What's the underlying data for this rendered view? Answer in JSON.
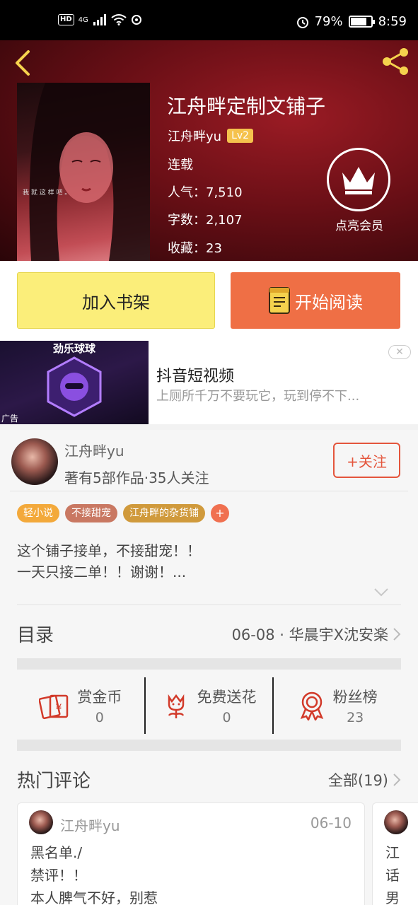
{
  "status_bar": {
    "hd": "HD",
    "network": "4G",
    "battery_percent": "79%",
    "battery_level": 0.79,
    "time": "8:59"
  },
  "header": {
    "title": "江舟畔定制文铺子",
    "author": "江舟畔yu",
    "level": "Lv2",
    "status": "连载",
    "popularity": "人气：7,510",
    "word_count": "字数：2,107",
    "favorites": "收藏：23",
    "vip_label": "点亮会员",
    "cover_text": "我 就 这 样 吧 。"
  },
  "actions": {
    "add_shelf": "加入书架",
    "start_read": "开始阅读"
  },
  "ad": {
    "image_title": "劲乐球球",
    "tag": "广告",
    "title": "抖音短视频",
    "description": "上厕所千万不要玩它，玩到停不下..."
  },
  "author_info": {
    "name": "江舟畔yu",
    "stats": "著有5部作品·35人关注",
    "follow_label": "+关注"
  },
  "tags": [
    {
      "label": "轻小说",
      "color": "#f3a93b"
    },
    {
      "label": "不接甜宠",
      "color": "#c97862"
    },
    {
      "label": "江舟畔的杂货铺",
      "color": "#d09a3c"
    }
  ],
  "description": {
    "line1": "这个铺子接单，不接甜宠！！",
    "line2": "一天只接二单！！谢谢！..."
  },
  "toc": {
    "title": "目录",
    "latest": "06-08 · 华晨宇X沈安楽"
  },
  "stats": [
    {
      "label": "赏金币",
      "value": "0",
      "icon": "reward-coin-icon"
    },
    {
      "label": "免费送花",
      "value": "0",
      "icon": "flower-icon"
    },
    {
      "label": "粉丝榜",
      "value": "23",
      "icon": "medal-icon"
    }
  ],
  "hot_comments": {
    "title": "热门评论",
    "all_label": "全部(19)",
    "items": [
      {
        "author": "江舟畔yu",
        "date": "06-10",
        "line1": "黑名单./",
        "line2": "禁评！！",
        "line3": "本人脾气不好，别惹"
      }
    ],
    "next_preview": {
      "line1": "江",
      "line2": "话",
      "line3": "男"
    }
  },
  "colors": {
    "accent_orange": "#ef6f45",
    "shelf_yellow": "#fbee7a",
    "follow_red": "#e4553c",
    "lv_badge": "#f5c24d"
  }
}
